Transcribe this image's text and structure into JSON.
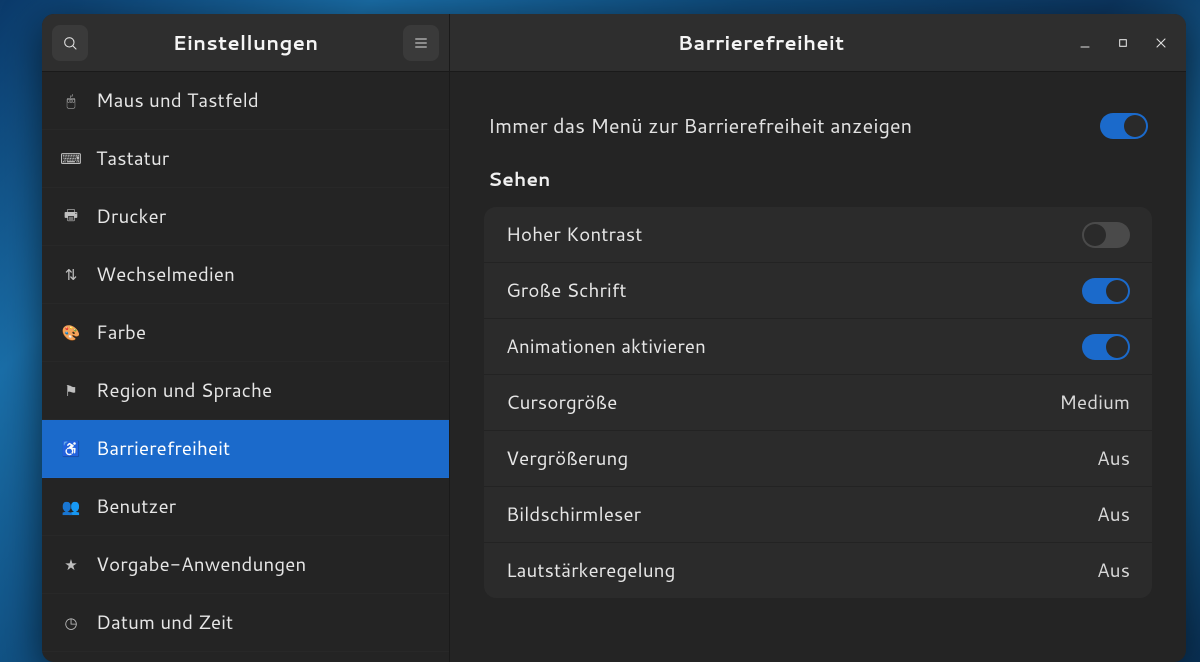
{
  "header": {
    "sidebar_title": "Einstellungen",
    "panel_title": "Barrierefreiheit"
  },
  "sidebar": {
    "items": [
      {
        "icon": "🖱",
        "label": "Maus und Tastfeld",
        "active": false
      },
      {
        "icon": "⌨",
        "label": "Tastatur",
        "active": false
      },
      {
        "icon": "🖶",
        "label": "Drucker",
        "active": false
      },
      {
        "icon": "⇅",
        "label": "Wechselmedien",
        "active": false
      },
      {
        "icon": "🎨",
        "label": "Farbe",
        "active": false
      },
      {
        "icon": "⚑",
        "label": "Region und Sprache",
        "active": false
      },
      {
        "icon": "♿",
        "label": "Barrierefreiheit",
        "active": true
      },
      {
        "icon": "👥",
        "label": "Benutzer",
        "active": false
      },
      {
        "icon": "★",
        "label": "Vorgabe-Anwendungen",
        "active": false
      },
      {
        "icon": "◷",
        "label": "Datum und Zeit",
        "active": false
      }
    ]
  },
  "panel": {
    "always_show_menu": {
      "label": "Immer das Menü zur Barrierefreiheit anzeigen",
      "value": true
    },
    "seeing": {
      "title": "Sehen",
      "rows": [
        {
          "kind": "switch",
          "label": "Hoher Kontrast",
          "value": false
        },
        {
          "kind": "switch",
          "label": "Große Schrift",
          "value": true
        },
        {
          "kind": "switch",
          "label": "Animationen aktivieren",
          "value": true
        },
        {
          "kind": "value",
          "label": "Cursorgröße",
          "value": "Medium"
        },
        {
          "kind": "value",
          "label": "Vergrößerung",
          "value": "Aus"
        },
        {
          "kind": "value",
          "label": "Bildschirmleser",
          "value": "Aus"
        },
        {
          "kind": "value",
          "label": "Lautstärkeregelung",
          "value": "Aus"
        }
      ]
    }
  }
}
